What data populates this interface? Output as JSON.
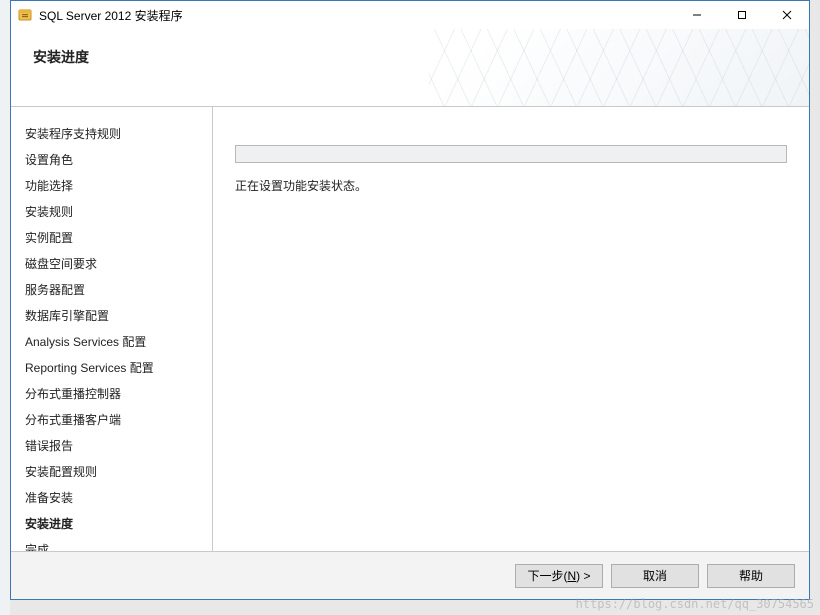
{
  "window": {
    "title": "SQL Server 2012 安装程序"
  },
  "header": {
    "title": "安装进度"
  },
  "sidebar": {
    "steps": [
      {
        "label": "安装程序支持规则",
        "active": false
      },
      {
        "label": "设置角色",
        "active": false
      },
      {
        "label": "功能选择",
        "active": false
      },
      {
        "label": "安装规则",
        "active": false
      },
      {
        "label": "实例配置",
        "active": false
      },
      {
        "label": "磁盘空间要求",
        "active": false
      },
      {
        "label": "服务器配置",
        "active": false
      },
      {
        "label": "数据库引擎配置",
        "active": false
      },
      {
        "label": "Analysis Services 配置",
        "active": false
      },
      {
        "label": "Reporting Services 配置",
        "active": false
      },
      {
        "label": "分布式重播控制器",
        "active": false
      },
      {
        "label": "分布式重播客户端",
        "active": false
      },
      {
        "label": "错误报告",
        "active": false
      },
      {
        "label": "安装配置规则",
        "active": false
      },
      {
        "label": "准备安装",
        "active": false
      },
      {
        "label": "安装进度",
        "active": true
      },
      {
        "label": "完成",
        "active": false
      }
    ]
  },
  "main": {
    "status_text": "正在设置功能安装状态。"
  },
  "footer": {
    "next_prefix": "下一步(",
    "next_mnemonic": "N",
    "next_suffix": ") >",
    "cancel": "取消",
    "help": "帮助"
  },
  "watermark": "https://blog.csdn.net/qq_30754565"
}
